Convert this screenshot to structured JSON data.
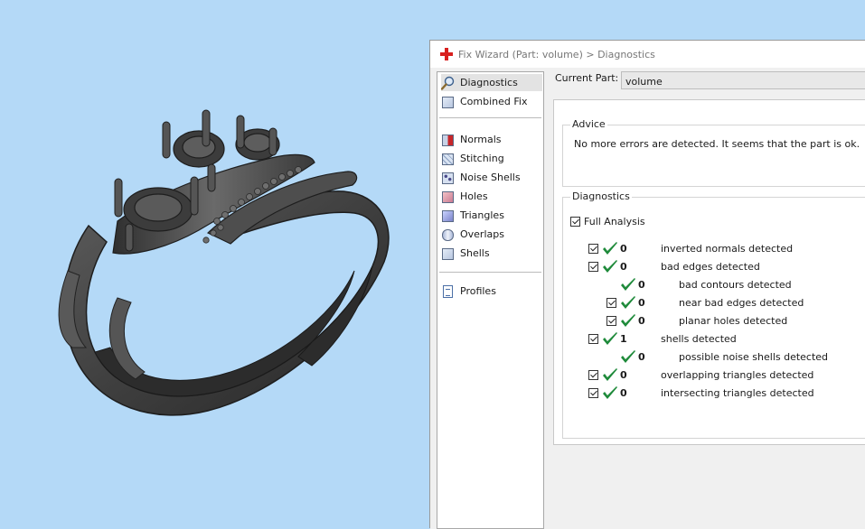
{
  "window": {
    "title": "Fix Wizard (Part: volume) > Diagnostics"
  },
  "nav": {
    "items": [
      {
        "label": "Diagnostics",
        "icon": "magnifier-icon"
      },
      {
        "label": "Combined Fix",
        "icon": "combined-fix-icon"
      },
      {
        "label": "Normals",
        "icon": "normals-icon"
      },
      {
        "label": "Stitching",
        "icon": "stitching-icon"
      },
      {
        "label": "Noise Shells",
        "icon": "noise-shells-icon"
      },
      {
        "label": "Holes",
        "icon": "holes-icon"
      },
      {
        "label": "Triangles",
        "icon": "triangles-icon"
      },
      {
        "label": "Overlaps",
        "icon": "overlaps-icon"
      },
      {
        "label": "Shells",
        "icon": "shells-icon"
      },
      {
        "label": "Profiles",
        "icon": "profiles-icon"
      }
    ],
    "selected": "Diagnostics"
  },
  "current_part": {
    "label": "Current Part:",
    "value": "volume"
  },
  "advice": {
    "title": "Advice",
    "text": "No more errors are detected. It seems that the part is ok."
  },
  "diagnostics": {
    "title": "Diagnostics",
    "full_analysis_label": "Full Analysis",
    "full_analysis_checked": true,
    "rows": [
      {
        "count": "0",
        "label": "inverted normals detected",
        "checked": true
      },
      {
        "count": "0",
        "label": "bad edges detected",
        "checked": true
      },
      {
        "count": "0",
        "label": "bad contours detected",
        "checked": false
      },
      {
        "count": "0",
        "label": "near bad edges detected",
        "checked": true
      },
      {
        "count": "0",
        "label": "planar holes detected",
        "checked": true
      },
      {
        "count": "1",
        "label": "shells detected",
        "checked": true
      },
      {
        "count": "0",
        "label": "possible noise shells detected",
        "checked": false
      },
      {
        "count": "0",
        "label": "overlapping triangles detected",
        "checked": true
      },
      {
        "count": "0",
        "label": "intersecting triangles detected",
        "checked": true
      }
    ]
  },
  "colors": {
    "viewport_background": "#b4d9f7",
    "model": "#4a4a4a",
    "tick_green": "#1e8a3a",
    "title_icon_red": "#d8201f"
  }
}
